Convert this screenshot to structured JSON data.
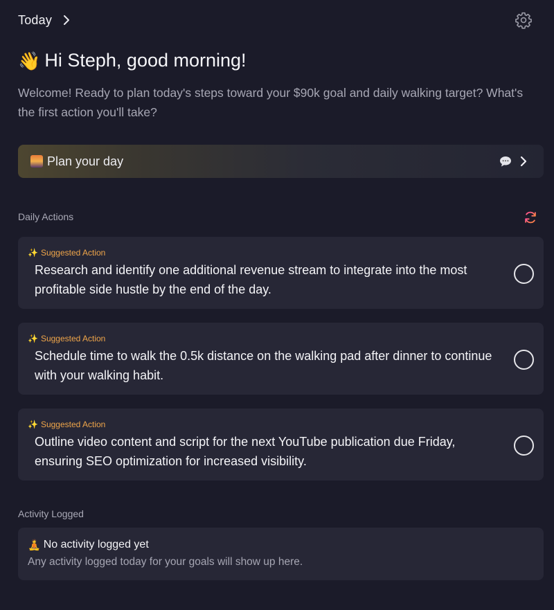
{
  "header": {
    "breadcrumb": "Today",
    "breadcrumb_icon": "chevron-right-icon",
    "settings_icon": "gear-icon"
  },
  "greeting": {
    "emoji": "👋",
    "text": "Hi Steph, good morning!",
    "intro": "Welcome! Ready to plan today's steps toward your $90k goal and daily walking target? What's the first action you'll take?"
  },
  "plan": {
    "emoji_icon": "sunrise-icon",
    "label": "Plan your day",
    "chat_icon": "speech-bubble-icon",
    "arrow_icon": "chevron-right-icon"
  },
  "daily_actions": {
    "label": "Daily Actions",
    "refresh_icon": "refresh-icon",
    "items": [
      {
        "tag": "Suggested Action",
        "text": "Research and identify one additional revenue stream to integrate into the most profitable side hustle by the end of the day.",
        "done": false
      },
      {
        "tag": "Suggested Action",
        "text": "Schedule time to walk the 0.5k distance on the walking pad after dinner to continue with your walking habit.",
        "done": false
      },
      {
        "tag": "Suggested Action",
        "text": "Outline video content and script for the next YouTube publication due Friday, ensuring SEO optimization for increased visibility.",
        "done": false
      }
    ]
  },
  "activity": {
    "label": "Activity Logged",
    "emoji": "🧘",
    "title": "No activity logged yet",
    "subtitle": "Any activity logged today for your goals will show up here."
  },
  "colors": {
    "background": "#1b1b29",
    "card": "#272736",
    "tag": "#f0a64a",
    "refresh_gradient": [
      "#ff5a8a",
      "#ff9a3c"
    ]
  }
}
